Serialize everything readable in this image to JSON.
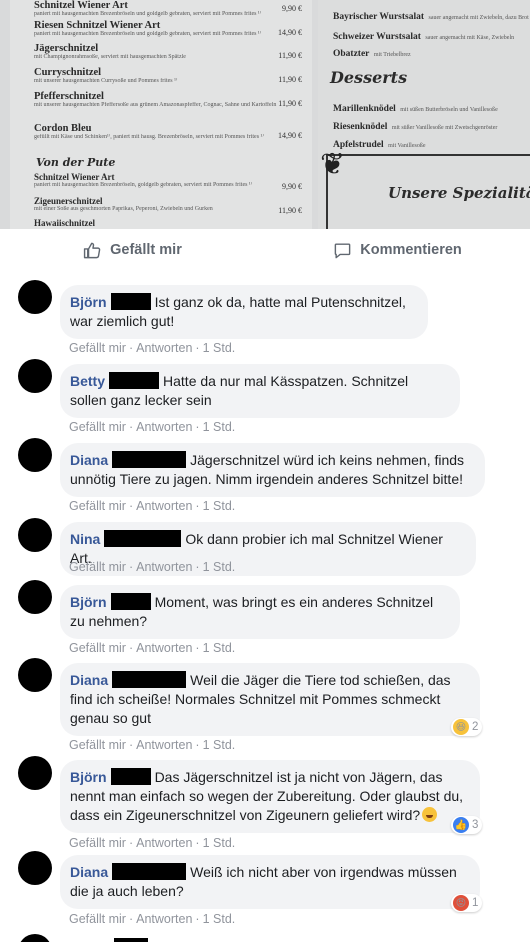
{
  "menu": {
    "left_items": [
      {
        "name": "Schnitzel Wiener Art",
        "desc": "paniert mit hausgemachten Brezenbröseln und goldgelb gebraten, serviert mit Pommes frites ¹⁾",
        "price": "9,90 €"
      },
      {
        "name": "Riesen Schnitzel Wiener Art",
        "desc": "paniert mit hausgemachten Brezenbröseln und goldgelb gebraten, serviert mit Pommes frites ¹⁾",
        "price": "14,90 €"
      },
      {
        "name": "Jägerschnitzel",
        "desc": "mit Champignonrahmsoße, serviert mit hausgemachten Spätzle",
        "price": "11,90 €"
      },
      {
        "name": "Curryschnitzel",
        "desc": "mit unserer hausgemachten Currysoße und Pommes frites ¹⁾",
        "price": "11,90 €"
      },
      {
        "name": "Pfefferschnitzel",
        "desc": "mit unserer hausgemachten Pfeffersoße aus grünem Amazonaspfeffer, Cognac, Sahne und Kartoffeln",
        "price": "11,90 €"
      },
      {
        "name": "Cordon Bleu",
        "desc": "gefüllt mit Käse und Schinken¹⁾, paniert mit hausg. Brezenbröseln, serviert mit Pommes frites ¹⁾",
        "price": "14,90 €"
      }
    ],
    "section_pute": "Von der Pute",
    "pute_items": [
      {
        "name": "Schnitzel Wiener Art",
        "desc": "paniert mit hausgemachten Brezenbröseln, goldgelb gebraten, serviert mit Pommes frites ¹⁾",
        "price": "9,90 €"
      },
      {
        "name": "Zigeunerschnitzel",
        "desc": "mit einer Soße aus geschmorten Paprikas, Peperoni, Zwiebeln und Gurken",
        "price": "11,90 €"
      },
      {
        "name": "Hawaiischnitzel",
        "desc": "",
        "price": ""
      }
    ],
    "right_items": [
      {
        "name": "Bayrischer Wurstsalat",
        "desc": "sauer angemacht mit Zwiebeln, dazu Brot"
      },
      {
        "name": "Schweizer Wurstsalat",
        "desc": "sauer angemacht mit Käse, Zwiebeln"
      },
      {
        "name": "Obatzter",
        "desc": "mit Triebelbrez"
      }
    ],
    "section_desserts": "Desserts",
    "dessert_items": [
      {
        "name": "Marillenknödel",
        "desc": "mit süßen Butterbröseln und Vanillesoße"
      },
      {
        "name": "Riesenknödel",
        "desc": "mit süßer Vanillesoße mit Zwetschgenröster"
      },
      {
        "name": "Apfelstrudel",
        "desc": "mit Vanillesoße"
      }
    ],
    "special_title": "Unsere Spezialitä"
  },
  "actions": {
    "like_label": "Gefällt mir",
    "comment_label": "Kommentieren"
  },
  "meta_labels": {
    "like": "Gefällt mir",
    "separator": "·",
    "reply": "Antworten"
  },
  "comments": [
    {
      "name": "Björn",
      "text": "Ist ganz ok da, hatte mal Putenschnitzel, war ziemlich gut!",
      "time": "1 Std."
    },
    {
      "name": "Betty",
      "text": "Hatte da nur mal Kässpatzen. Schnitzel sollen ganz lecker sein",
      "time": "1 Std."
    },
    {
      "name": "Diana",
      "text": "Jägerschnitzel würd ich keins nehmen, finds unnötig Tiere zu jagen. Nimm irgendein anderes Schnitzel bitte!",
      "time": "1 Std."
    },
    {
      "name": "Nina",
      "text": "Ok dann probier ich mal Schnitzel Wiener Art.",
      "time": "1 Std."
    },
    {
      "name": "Björn",
      "text": "Moment, was bringt es ein anderes Schnitzel zu nehmen?",
      "time": "1 Std."
    },
    {
      "name": "Diana",
      "text": "Weil die Jäger die Tiere tod schießen, das find ich scheiße! Normales Schnitzel mit Pommes schmeckt genau so gut",
      "time": "1 Std.",
      "reaction": {
        "type": "haha",
        "count": "2"
      }
    },
    {
      "name": "Björn",
      "text": "Das Jägerschnitzel ist ja nicht von Jägern, das nennt man einfach so wegen der Zubereitung. Oder glaubst du, dass ein Zigeunerschnitzel von Zigeunern geliefert wird?",
      "time": "1 Std.",
      "emoji": "grinning-sweat",
      "reaction": {
        "type": "like",
        "count": "3"
      }
    },
    {
      "name": "Diana",
      "text": "Weiß ich nicht aber von irgendwas müssen die ja auch leben?",
      "time": "1 Std.",
      "reaction": {
        "type": "angry",
        "count": "1"
      }
    }
  ],
  "colors": {
    "name": "#385898",
    "bubble": "#f2f3f5",
    "meta": "#90949c",
    "action": "#606770"
  }
}
